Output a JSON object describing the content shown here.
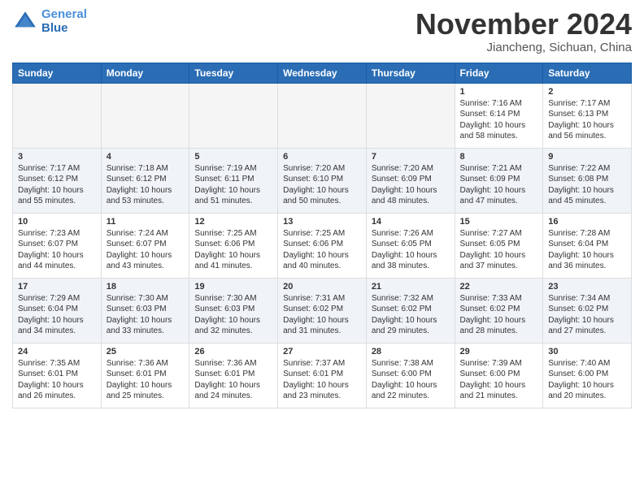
{
  "header": {
    "logo_line1": "General",
    "logo_line2": "Blue",
    "month_title": "November 2024",
    "subtitle": "Jiancheng, Sichuan, China"
  },
  "weekdays": [
    "Sunday",
    "Monday",
    "Tuesday",
    "Wednesday",
    "Thursday",
    "Friday",
    "Saturday"
  ],
  "weeks": [
    [
      {
        "day": "",
        "info": ""
      },
      {
        "day": "",
        "info": ""
      },
      {
        "day": "",
        "info": ""
      },
      {
        "day": "",
        "info": ""
      },
      {
        "day": "",
        "info": ""
      },
      {
        "day": "1",
        "info": "Sunrise: 7:16 AM\nSunset: 6:14 PM\nDaylight: 10 hours and 58 minutes."
      },
      {
        "day": "2",
        "info": "Sunrise: 7:17 AM\nSunset: 6:13 PM\nDaylight: 10 hours and 56 minutes."
      }
    ],
    [
      {
        "day": "3",
        "info": "Sunrise: 7:17 AM\nSunset: 6:12 PM\nDaylight: 10 hours and 55 minutes."
      },
      {
        "day": "4",
        "info": "Sunrise: 7:18 AM\nSunset: 6:12 PM\nDaylight: 10 hours and 53 minutes."
      },
      {
        "day": "5",
        "info": "Sunrise: 7:19 AM\nSunset: 6:11 PM\nDaylight: 10 hours and 51 minutes."
      },
      {
        "day": "6",
        "info": "Sunrise: 7:20 AM\nSunset: 6:10 PM\nDaylight: 10 hours and 50 minutes."
      },
      {
        "day": "7",
        "info": "Sunrise: 7:20 AM\nSunset: 6:09 PM\nDaylight: 10 hours and 48 minutes."
      },
      {
        "day": "8",
        "info": "Sunrise: 7:21 AM\nSunset: 6:09 PM\nDaylight: 10 hours and 47 minutes."
      },
      {
        "day": "9",
        "info": "Sunrise: 7:22 AM\nSunset: 6:08 PM\nDaylight: 10 hours and 45 minutes."
      }
    ],
    [
      {
        "day": "10",
        "info": "Sunrise: 7:23 AM\nSunset: 6:07 PM\nDaylight: 10 hours and 44 minutes."
      },
      {
        "day": "11",
        "info": "Sunrise: 7:24 AM\nSunset: 6:07 PM\nDaylight: 10 hours and 43 minutes."
      },
      {
        "day": "12",
        "info": "Sunrise: 7:25 AM\nSunset: 6:06 PM\nDaylight: 10 hours and 41 minutes."
      },
      {
        "day": "13",
        "info": "Sunrise: 7:25 AM\nSunset: 6:06 PM\nDaylight: 10 hours and 40 minutes."
      },
      {
        "day": "14",
        "info": "Sunrise: 7:26 AM\nSunset: 6:05 PM\nDaylight: 10 hours and 38 minutes."
      },
      {
        "day": "15",
        "info": "Sunrise: 7:27 AM\nSunset: 6:05 PM\nDaylight: 10 hours and 37 minutes."
      },
      {
        "day": "16",
        "info": "Sunrise: 7:28 AM\nSunset: 6:04 PM\nDaylight: 10 hours and 36 minutes."
      }
    ],
    [
      {
        "day": "17",
        "info": "Sunrise: 7:29 AM\nSunset: 6:04 PM\nDaylight: 10 hours and 34 minutes."
      },
      {
        "day": "18",
        "info": "Sunrise: 7:30 AM\nSunset: 6:03 PM\nDaylight: 10 hours and 33 minutes."
      },
      {
        "day": "19",
        "info": "Sunrise: 7:30 AM\nSunset: 6:03 PM\nDaylight: 10 hours and 32 minutes."
      },
      {
        "day": "20",
        "info": "Sunrise: 7:31 AM\nSunset: 6:02 PM\nDaylight: 10 hours and 31 minutes."
      },
      {
        "day": "21",
        "info": "Sunrise: 7:32 AM\nSunset: 6:02 PM\nDaylight: 10 hours and 29 minutes."
      },
      {
        "day": "22",
        "info": "Sunrise: 7:33 AM\nSunset: 6:02 PM\nDaylight: 10 hours and 28 minutes."
      },
      {
        "day": "23",
        "info": "Sunrise: 7:34 AM\nSunset: 6:02 PM\nDaylight: 10 hours and 27 minutes."
      }
    ],
    [
      {
        "day": "24",
        "info": "Sunrise: 7:35 AM\nSunset: 6:01 PM\nDaylight: 10 hours and 26 minutes."
      },
      {
        "day": "25",
        "info": "Sunrise: 7:36 AM\nSunset: 6:01 PM\nDaylight: 10 hours and 25 minutes."
      },
      {
        "day": "26",
        "info": "Sunrise: 7:36 AM\nSunset: 6:01 PM\nDaylight: 10 hours and 24 minutes."
      },
      {
        "day": "27",
        "info": "Sunrise: 7:37 AM\nSunset: 6:01 PM\nDaylight: 10 hours and 23 minutes."
      },
      {
        "day": "28",
        "info": "Sunrise: 7:38 AM\nSunset: 6:00 PM\nDaylight: 10 hours and 22 minutes."
      },
      {
        "day": "29",
        "info": "Sunrise: 7:39 AM\nSunset: 6:00 PM\nDaylight: 10 hours and 21 minutes."
      },
      {
        "day": "30",
        "info": "Sunrise: 7:40 AM\nSunset: 6:00 PM\nDaylight: 10 hours and 20 minutes."
      }
    ]
  ]
}
